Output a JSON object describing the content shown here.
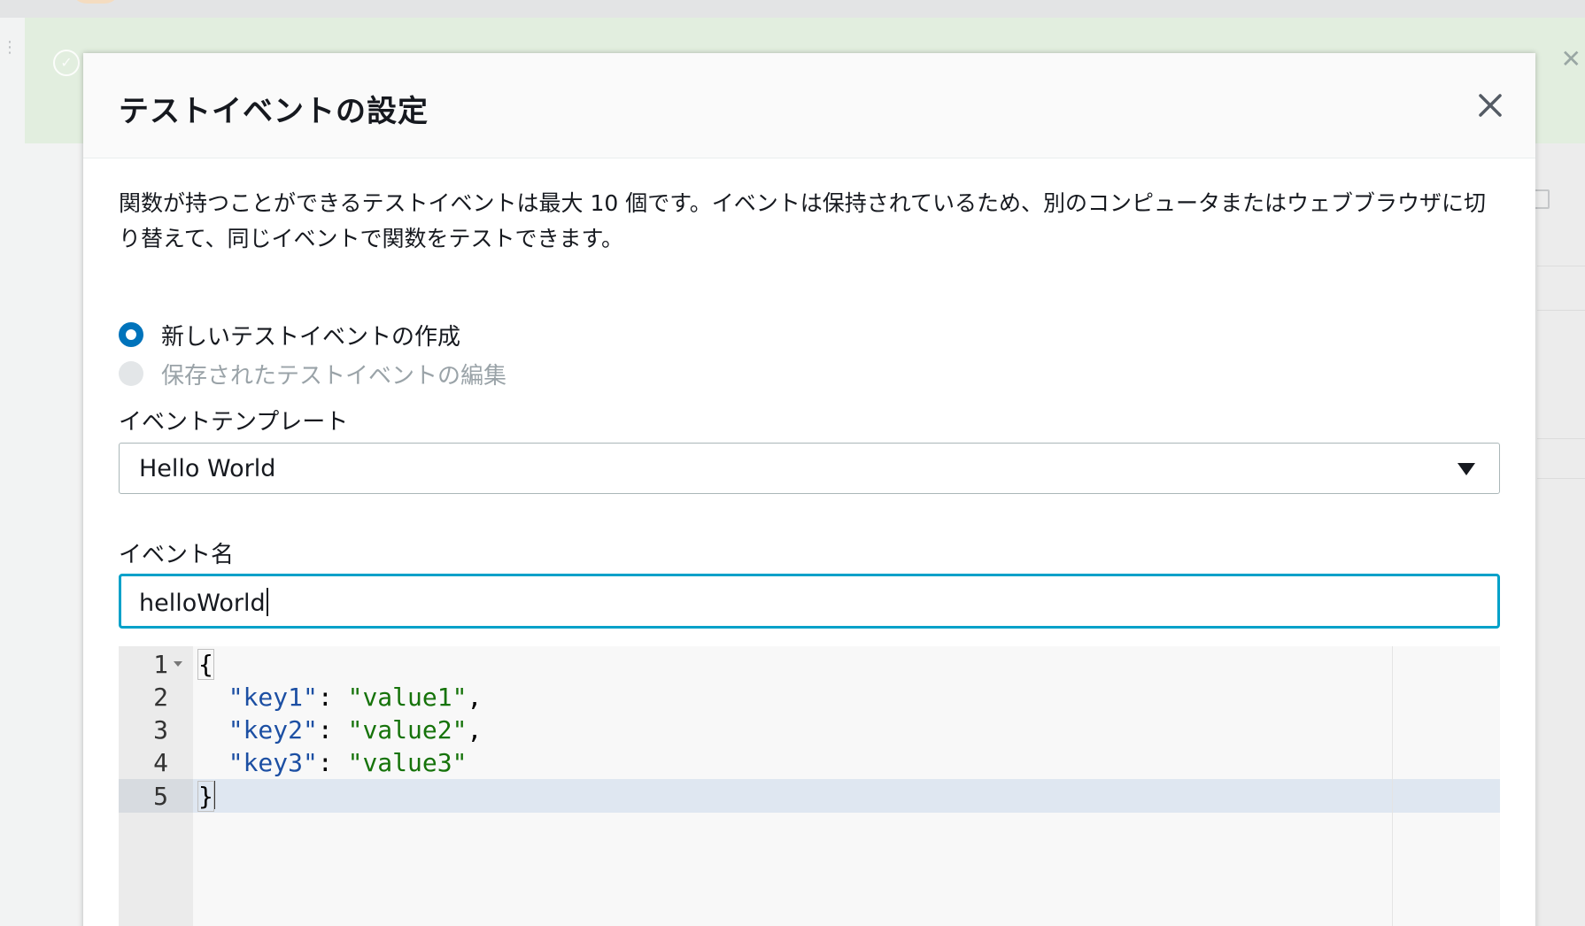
{
  "modal": {
    "title": "テストイベントの設定",
    "close_icon": "close-icon",
    "description": "関数が持つことができるテストイベントは最大 10 個です。イベントは保持されているため、別のコンピュータまたはウェブブラウザに切り替えて、同じイベントで関数をテストできます。",
    "radio_options": [
      {
        "label": "新しいテストイベントの作成",
        "selected": true,
        "disabled": false
      },
      {
        "label": "保存されたテストイベントの編集",
        "selected": false,
        "disabled": true
      }
    ],
    "template": {
      "label": "イベントテンプレート",
      "value": "Hello World",
      "icon": "caret-down-icon"
    },
    "event_name": {
      "label": "イベント名",
      "value": "helloWorld"
    },
    "editor": {
      "lines": [
        {
          "num": "1",
          "open": "{"
        },
        {
          "num": "2",
          "key": "\"key1\"",
          "colon": ": ",
          "value": "\"value1\"",
          "comma": ","
        },
        {
          "num": "3",
          "key": "\"key2\"",
          "colon": ": ",
          "value": "\"value2\"",
          "comma": ","
        },
        {
          "num": "4",
          "key": "\"key3\"",
          "colon": ": ",
          "value": "\"value3\""
        },
        {
          "num": "5",
          "close": "}"
        }
      ]
    }
  },
  "colors": {
    "accent": "#0073bb",
    "focus_border": "#00a1c9",
    "json_key": "#1c4fa3",
    "json_string": "#16730a",
    "success_flash": "#e2eedf"
  }
}
